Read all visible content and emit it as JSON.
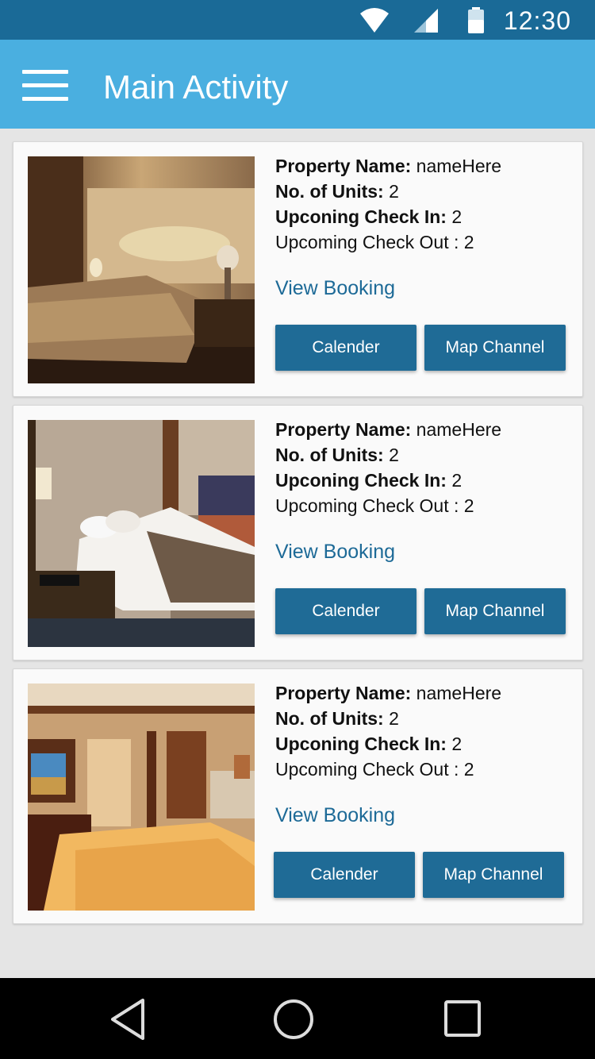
{
  "status_bar": {
    "time": "12:30"
  },
  "app_bar": {
    "title": "Main Activity"
  },
  "labels": {
    "property_name": "Property Name:",
    "units": "No. of Units:",
    "check_in": "Upconing Check In:",
    "check_out": "Upcoming Check Out"
  },
  "properties": [
    {
      "name": "nameHere",
      "units": "2",
      "check_in": "2",
      "check_out": ": 2",
      "view_booking": "View Booking",
      "calendar_label": "Calender",
      "map_label": "Map Channel"
    },
    {
      "name": "nameHere",
      "units": "2",
      "check_in": "2",
      "check_out": ": 2",
      "view_booking": "View Booking",
      "calendar_label": "Calender",
      "map_label": "Map Channel"
    },
    {
      "name": "nameHere",
      "units": "2",
      "check_in": "2",
      "check_out": ": 2",
      "view_booking": "View Booking",
      "calendar_label": "Calender",
      "map_label": "Map Channel"
    }
  ],
  "colors": {
    "status_bar": "#1a6a97",
    "app_bar": "#4aafe0",
    "button": "#1f6b96",
    "link": "#1d6a97"
  }
}
